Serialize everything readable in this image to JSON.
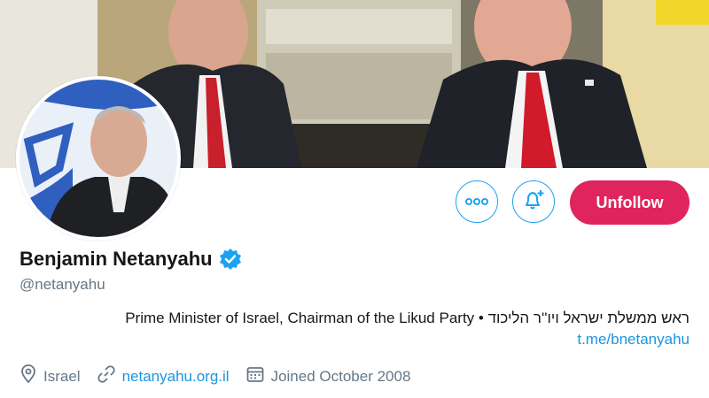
{
  "profile": {
    "name": "Benjamin Netanyahu",
    "handle": "@netanyahu",
    "bio_text": "ראש ממשלת ישראל ויו''ר הליכוד • Prime Minister of Israel, Chairman of the Likud Party",
    "bio_link": "t.me/bnetanyahu",
    "location": "Israel",
    "website": "netanyahu.org.il",
    "joined": "Joined October 2008"
  },
  "actions": {
    "more_icon": "more-icon",
    "notifications_icon": "bell-plus-icon",
    "unfollow_label": "Unfollow"
  },
  "colors": {
    "accent": "#1da1f2",
    "link": "#1b95e0",
    "unfollow": "#e0245e",
    "secondary_text": "#657786"
  }
}
